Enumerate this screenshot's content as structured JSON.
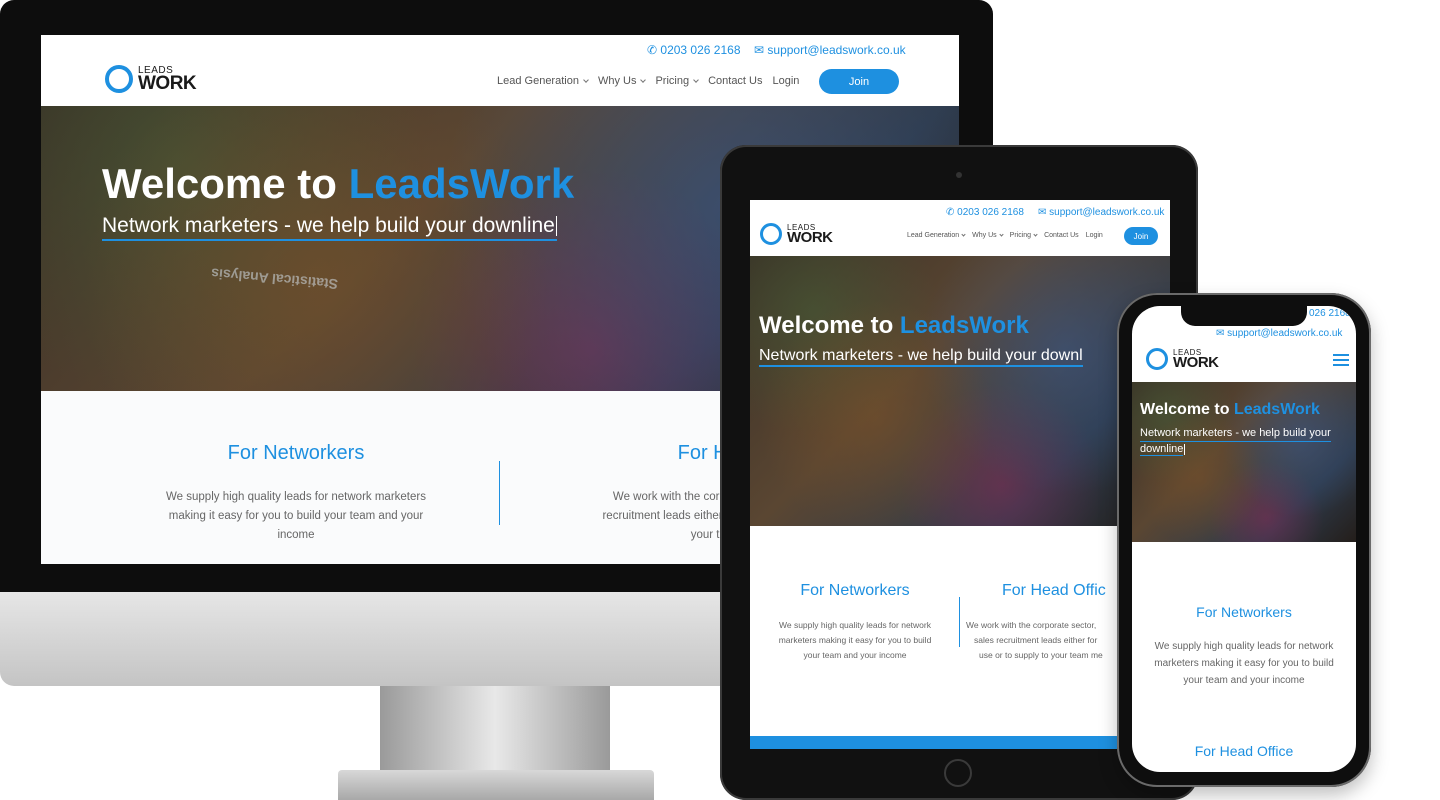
{
  "site": {
    "phone": "0203 026 2168",
    "phone_partial": "026 2168",
    "email": "support@leadswork.co.uk",
    "logo_top": "LEADS",
    "logo_bottom": "WORK",
    "logo_tm": "™",
    "nav": [
      {
        "label": "Lead Generation",
        "has_dropdown": true
      },
      {
        "label": "Why Us",
        "has_dropdown": true
      },
      {
        "label": "Pricing",
        "has_dropdown": true
      },
      {
        "label": "Contact Us",
        "has_dropdown": false
      },
      {
        "label": "Login",
        "has_dropdown": false
      }
    ],
    "join_label": "Join",
    "hero": {
      "title_prefix": "Welcome to ",
      "title_brand": "LeadsWork",
      "subtitle": "Network marketers - we help build your downline",
      "subtitle_cut": "Network marketers - we help build your downl",
      "mobile_sub_line1": "Network marketers - we help build your",
      "mobile_sub_line2": "downline",
      "bg_text": "Statistical Analysis"
    },
    "networkers": {
      "title": "For Networkers",
      "body_desktop": [
        "We supply high quality leads for network marketers",
        "making it easy for you to build your team and your",
        "income"
      ],
      "body_tablet": [
        "We supply high quality leads for network",
        "marketers making it easy for you to build",
        "your team and your income"
      ],
      "body_mobile": [
        "We supply high quality leads for network",
        "marketers making it easy for you to build",
        "your team and your income"
      ]
    },
    "head_office": {
      "title_desktop": "For Head",
      "title_tablet": "For Head Offic",
      "title_mobile": "For Head Office",
      "body_desktop": [
        "We work with the corporate s",
        "recruitment leads either for you",
        "your team me"
      ],
      "body_tablet": [
        "We work with the corporate sector,",
        "sales recruitment leads either for",
        "use or to supply to your team me"
      ]
    }
  },
  "colors": {
    "accent": "#1e90e0",
    "device_dark": "#111111",
    "stand_silver": "#c8c8c8"
  },
  "icons": {
    "phone": "phone-icon",
    "email": "envelope-icon",
    "menu": "hamburger-menu-icon",
    "dropdown": "chevron-down-icon"
  }
}
